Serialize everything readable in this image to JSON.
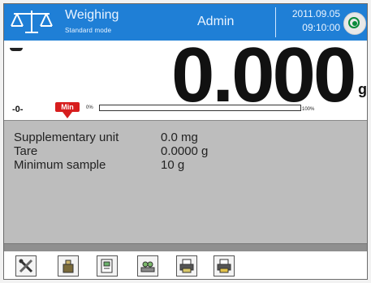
{
  "header": {
    "mode_title": "Weighing",
    "mode_subtitle": "Standard mode",
    "user": "Admin",
    "date": "2011.09.05",
    "time": "09:10:00",
    "accent_color": "#1f7fd6"
  },
  "display": {
    "weight": "0.000",
    "unit": "g",
    "zero_indicator": "-0-",
    "min_badge": "Min",
    "bar_start_label": "0%",
    "bar_end_label": "100%",
    "bar_fill_fraction": 0.0
  },
  "info": {
    "rows": [
      {
        "label": "Supplementary unit",
        "value": "0.0 mg"
      },
      {
        "label": "Tare",
        "value": "0.0000 g"
      },
      {
        "label": "Minimum sample",
        "value": "10 g"
      }
    ]
  },
  "toolbar": {
    "buttons": [
      {
        "icon": "settings-tools-icon"
      },
      {
        "icon": "product-icon"
      },
      {
        "icon": "report-icon"
      },
      {
        "icon": "weigh-items-icon"
      },
      {
        "icon": "printer-icon"
      },
      {
        "icon": "printer-alt-icon"
      }
    ]
  }
}
